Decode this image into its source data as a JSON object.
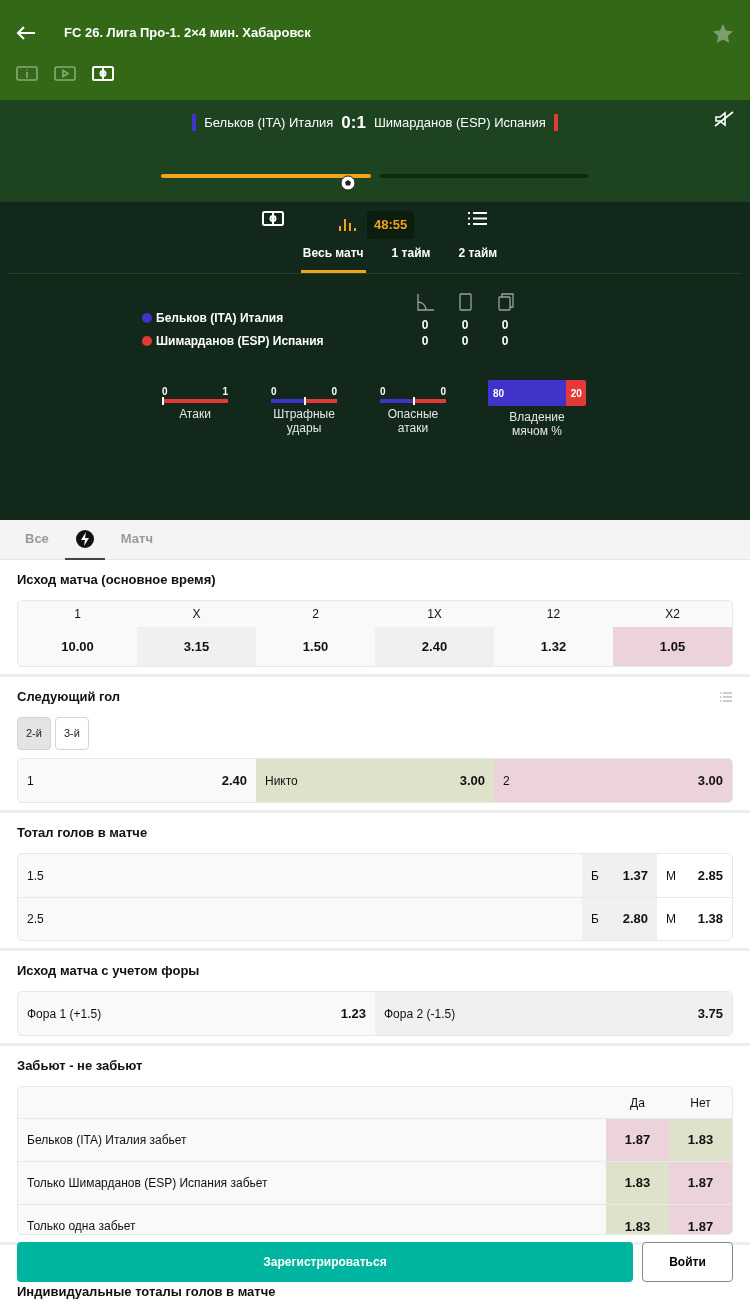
{
  "header": {
    "title": "FC 26. Лига Про-1. 2×4 мин. Хабаровск",
    "favorite": false
  },
  "view_tabs": [
    {
      "kind": "info",
      "selected": false
    },
    {
      "kind": "video",
      "selected": false
    },
    {
      "kind": "field",
      "selected": true
    }
  ],
  "scoreboard": {
    "home": {
      "name": "Бельков (ITA) Италия",
      "color": "#3f33c9"
    },
    "score": "0:1",
    "away": {
      "name": "Шимарданов (ESP) Испания",
      "color": "#e53935"
    },
    "muted": true,
    "halves": [
      {
        "level": 1
      },
      {
        "level": 0
      }
    ]
  },
  "stats_tabs": [
    {
      "kind": "field",
      "selected": false
    },
    {
      "kind": "chart",
      "selected": true,
      "timer": "48:55"
    },
    {
      "kind": "list",
      "selected": false
    }
  ],
  "period_tabs": [
    {
      "label": "Весь матч",
      "selected": true
    },
    {
      "label": "1 тайм",
      "selected": false
    },
    {
      "label": "2 тайм",
      "selected": false
    }
  ],
  "stats_table": {
    "columns": [
      {
        "kind": "corner"
      },
      {
        "kind": "card"
      },
      {
        "kind": "cards"
      }
    ],
    "teams": [
      {
        "name": "Бельков (ITA) Италия",
        "color": "#3f33c9",
        "values": [
          "0",
          "0",
          "0"
        ]
      },
      {
        "name": "Шимарданов (ESP) Испания",
        "color": "#e53935",
        "values": [
          "0",
          "0",
          "0"
        ]
      }
    ]
  },
  "bars": [
    {
      "label": "Атаки",
      "home": "0",
      "away": "1",
      "level": 0
    },
    {
      "label": "Штрафные удары",
      "home": "0",
      "away": "0",
      "level": 0.5
    },
    {
      "label": "Опасные атаки",
      "home": "0",
      "away": "0",
      "level": 0.5
    }
  ],
  "possession": {
    "label": "Владение мячом %",
    "home": "80",
    "away": "20",
    "level": 0.8
  },
  "market_tabs": [
    {
      "kind": "text",
      "label": "Все",
      "selected": false
    },
    {
      "kind": "icon",
      "selected": true
    },
    {
      "kind": "text",
      "label": "Матч",
      "selected": false
    }
  ],
  "markets": [
    {
      "kind": "grid",
      "title": "Исход матча (основное время)",
      "outcomes": [
        {
          "label": "1",
          "odds": "10.00",
          "up": false,
          "down": false
        },
        {
          "label": "X",
          "odds": "3.15",
          "up": false,
          "down": false
        },
        {
          "label": "2",
          "odds": "1.50",
          "up": false,
          "down": false
        },
        {
          "label": "1X",
          "odds": "2.40",
          "up": false,
          "down": false
        },
        {
          "label": "12",
          "odds": "1.32",
          "up": false,
          "down": false
        },
        {
          "label": "X2",
          "odds": "1.05",
          "up": false,
          "down": true
        }
      ]
    },
    {
      "kind": "next_goal",
      "title": "Следующий гол",
      "options": [
        {
          "label": "2-й",
          "selected": true
        },
        {
          "label": "3-й",
          "selected": false
        }
      ],
      "outcomes": [
        {
          "label": "1",
          "odds": "2.40",
          "up": false,
          "down": false
        },
        {
          "label": "Никто",
          "odds": "3.00",
          "up": true,
          "down": false
        },
        {
          "label": "2",
          "odds": "3.00",
          "up": false,
          "down": true
        }
      ]
    },
    {
      "kind": "totals",
      "title": "Тотал голов в матче",
      "rows": [
        {
          "line": "1.5",
          "over_label": "Б",
          "over": "1.37",
          "under_label": "М",
          "under": "2.85"
        },
        {
          "line": "2.5",
          "over_label": "Б",
          "over": "2.80",
          "under_label": "М",
          "under": "1.38"
        }
      ]
    },
    {
      "kind": "handicap",
      "title": "Исход матча с учетом форы",
      "outcomes": [
        {
          "label": "Фора 1 (+1.5)",
          "odds": "1.23",
          "up": false,
          "down": false
        },
        {
          "label": "Фора 2  (-1.5)",
          "odds": "3.75",
          "up": false,
          "down": false
        }
      ]
    },
    {
      "kind": "yes_no",
      "title": "Забьют - не забьют",
      "columns": [
        "Да",
        "Нет"
      ],
      "rows": [
        {
          "label": "Бельков (ITA) Италия забьет",
          "yes": {
            "odds": "1.87",
            "up": false,
            "down": true
          },
          "no": {
            "odds": "1.83",
            "up": true,
            "down": false
          }
        },
        {
          "label": "Только Шимарданов (ESP) Испания забьет",
          "yes": {
            "odds": "1.83",
            "up": true,
            "down": false
          },
          "no": {
            "odds": "1.87",
            "up": false,
            "down": true
          }
        },
        {
          "label": "Только одна забьет",
          "yes": {
            "odds": "1.83",
            "up": true,
            "down": false
          },
          "no": {
            "odds": "1.87",
            "up": false,
            "down": true
          }
        }
      ]
    },
    {
      "kind": "heading",
      "title": "Индивидуальные тоталы голов в матче"
    }
  ],
  "footer": {
    "register": "Зарегистрироваться",
    "login": "Войти"
  }
}
